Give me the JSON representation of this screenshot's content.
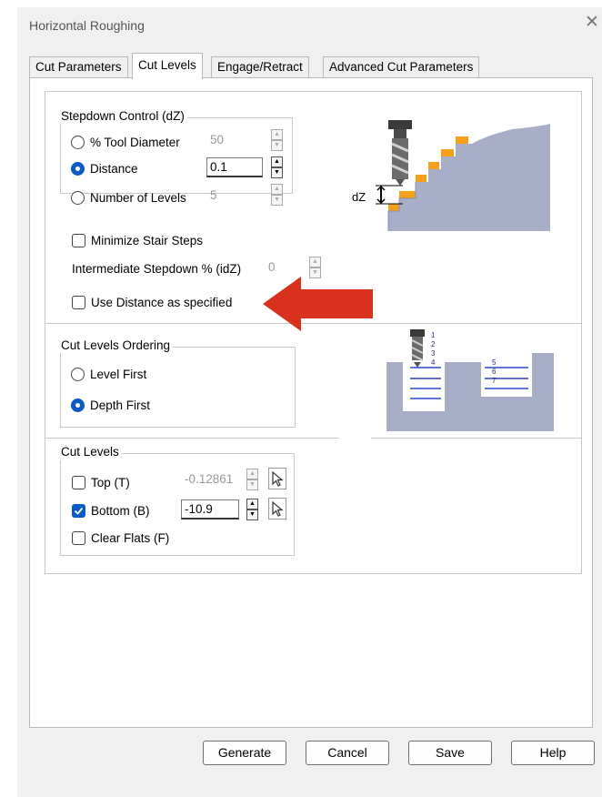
{
  "window": {
    "title": "Horizontal Roughing"
  },
  "tabs": [
    {
      "label": "Cut Parameters"
    },
    {
      "label": "Cut Levels"
    },
    {
      "label": "Engage/Retract"
    },
    {
      "label": "Advanced Cut Parameters"
    }
  ],
  "active_tab": "Cut Levels",
  "stepdown": {
    "legend": "Stepdown Control (dZ)",
    "options": [
      {
        "label": "% Tool Diameter",
        "value": "50",
        "selected": false
      },
      {
        "label": "Distance",
        "value": "0.1",
        "selected": true
      },
      {
        "label": "Number of Levels",
        "value": "5",
        "selected": false
      }
    ],
    "minimize_stair_steps": {
      "label": "Minimize Stair Steps",
      "checked": false
    },
    "intermediate": {
      "label": "Intermediate Stepdown % (idZ)",
      "value": "0"
    },
    "use_distance": {
      "label": "Use Distance as specified",
      "checked": false
    },
    "diagram_label": "dZ"
  },
  "ordering": {
    "legend": "Cut Levels Ordering",
    "options": [
      {
        "label": "Level First",
        "selected": false
      },
      {
        "label": "Depth First",
        "selected": true
      }
    ],
    "diagram_numbers": [
      "1",
      "2",
      "3",
      "4",
      "5",
      "6",
      "7"
    ]
  },
  "cut_levels": {
    "legend": "Cut Levels",
    "top": {
      "label": "Top (T)",
      "value": "-0.12861",
      "checked": false
    },
    "bottom": {
      "label": "Bottom (B)",
      "value": "-10.9",
      "checked": true
    },
    "clear_flats": {
      "label": "Clear Flats (F)",
      "checked": false
    }
  },
  "buttons": {
    "generate": "Generate",
    "cancel": "Cancel",
    "save": "Save",
    "help": "Help"
  },
  "colors": {
    "accent": "#0a5cc2",
    "arrow": "#d8321e",
    "diagram_material": "#a9aec8",
    "diagram_step": "#f5a01a"
  }
}
